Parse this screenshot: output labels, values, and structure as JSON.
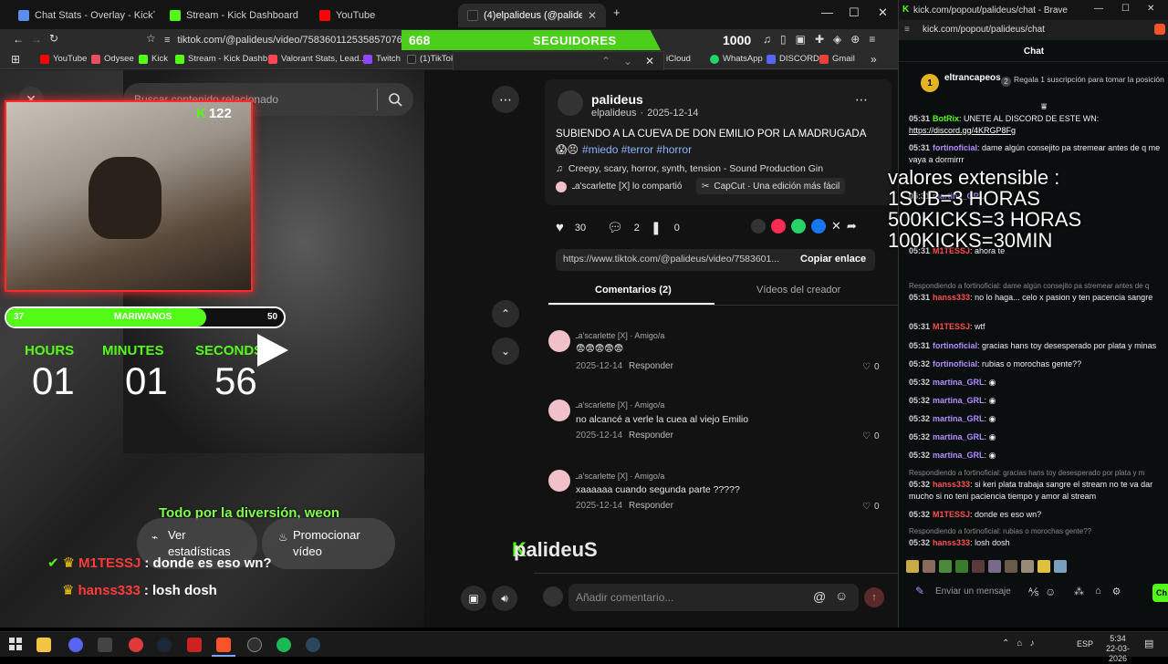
{
  "tabs": [
    {
      "label": "Chat Stats - Overlay - KickTools",
      "color": "#5b8def"
    },
    {
      "label": "Stream - Kick Dashboard",
      "color": "#53fc18"
    },
    {
      "label": "YouTube",
      "color": "#ff0000"
    },
    {
      "label": "(4)elpalideus (@palideus) | TikTok",
      "color": "#222222"
    }
  ],
  "address": "tiktok.com/@palideus/video/7583601125358570763",
  "bookmarks": [
    {
      "label": "YouTube",
      "color": "#ff0000"
    },
    {
      "label": "Odysee",
      "color": "#e5505a"
    },
    {
      "label": "Kick",
      "color": "#53fc18"
    },
    {
      "label": "Stream - Kick Dashb...",
      "color": "#53fc18"
    },
    {
      "label": "Valorant Stats, Lead...",
      "color": "#ff4655"
    },
    {
      "label": "Twitch",
      "color": "#9146ff"
    },
    {
      "label": "(1)TikTok",
      "color": "#222222"
    },
    {
      "label": "iCloud",
      "color": "#bbbbbb"
    },
    {
      "label": "WhatsApp",
      "color": "#25d366"
    },
    {
      "label": "DISCORD",
      "color": "#5865f2"
    },
    {
      "label": "Gmail",
      "color": "#ea4335"
    }
  ],
  "followers_overlay": {
    "current": "668",
    "label": "SEGUIDORES",
    "goal": "1000"
  },
  "search": {
    "placeholder": "Buscar contenido relacionado"
  },
  "viewer_count": "122",
  "goal_bar": {
    "start": "37",
    "label": "MARIWANOS",
    "end": "50",
    "fraction": 0.72
  },
  "timer": {
    "hours_label": "HOURS",
    "minutes_label": "MINUTES",
    "seconds_label": "SECONDS",
    "hours": "01",
    "minutes": "01",
    "seconds": "56"
  },
  "overlay_caption": "Todo por la diversión, weon",
  "video_buttons": {
    "stats": "Ver estadísticas",
    "promote": "Promocionar vídeo"
  },
  "overlay_chat": [
    {
      "user": "M1TESSJ",
      "text": ": donde es eso wn?",
      "color": "#ff3a3a"
    },
    {
      "user": "hanss333",
      "text": ": losh dosh",
      "color": "#ff3a3a"
    }
  ],
  "overlay_brand": "palideuS",
  "post": {
    "author_name": "palideus",
    "author_handle": "elpalideus",
    "date": "2025-12-14",
    "caption": "SUBIENDO A LA CUEVA DE DON EMILIO POR LA MADRUGADA",
    "tags": "#miedo #terror #horror",
    "sound": "Creepy, scary, horror, synth, tension - Sound Production Gin",
    "shared_by": "ـa'scarlette [X] lo compartió",
    "capcut": "CapCut · Una edición más fácil",
    "likes": "30",
    "comments": "2",
    "saves": "0",
    "link": "https://www.tiktok.com/@palideus/video/7583601...",
    "copy_label": "Copiar enlace",
    "tab_comments": "Comentarios (2)",
    "tab_videos": "Vídeos del creador"
  },
  "comments": [
    {
      "user": "ـa'scarlette [X] · Amigo/a",
      "text": "😨😨😨😨😨",
      "date": "2025-12-14",
      "reply": "Responder",
      "likes": "0"
    },
    {
      "user": "ـa'scarlette [X] · Amigo/a",
      "text": "no alcancé a verle la cuea al viejo Emilio",
      "date": "2025-12-14",
      "reply": "Responder",
      "likes": "0"
    },
    {
      "user": "ـa'scarlette [X] · Amigo/a",
      "text": "xaaaaaa cuando segunda parte ?????",
      "date": "2025-12-14",
      "reply": "Responder",
      "likes": "0"
    }
  ],
  "comment_input": {
    "placeholder": "Añadir comentario..."
  },
  "chat_window": {
    "address": "kick.com/popout/palideus/chat - Brave",
    "url": "kick.com/popout/palideus/chat",
    "header": "Chat",
    "pinned_user": "eltrancapeos",
    "pinned_count": "1",
    "gift_text": "Regala 1 suscripción para tomar la posición",
    "gift_pos": "2",
    "input_placeholder": "Enviar un mensaje",
    "send_label": "Ch"
  },
  "extension_overlay": [
    "valores extensible :",
    "1SUB=3 HORAS",
    "500KICKS=3 HORAS",
    "100KICKS=30MIN"
  ],
  "chat_messages": [
    {
      "time": "05:31",
      "user": "BotRix",
      "color": "#53fc18",
      "text": ": UNETE AL DISCORD DE ESTE WN:",
      "link": "https://discord.gg/4KRGP8Fg"
    },
    {
      "time": "05:31",
      "user": "fortinoficial",
      "color": "#b28dff",
      "text": ": dame algún consejito pa stremear antes de q me vaya a dormirrr"
    },
    {
      "time": "05:31",
      "user": "martina_GRL",
      "color": "#b28dff",
      "text": ":"
    },
    {
      "time": "05:31",
      "user": "M1TESSJ",
      "color": "#ff4d4d",
      "text": ": ahora te"
    },
    {
      "time": "05:31",
      "user": "hanss333",
      "color": "#ff4d4d",
      "text": ": no lo haga... celo x pasion y ten pacencia sangre"
    },
    {
      "time": "05:31",
      "user": "M1TESSJ",
      "color": "#ff4d4d",
      "text": ": wtf"
    },
    {
      "time": "05:31",
      "user": "fortinoficial",
      "color": "#b28dff",
      "text": ": gracias hans toy desesperado por plata y minas"
    },
    {
      "time": "05:32",
      "user": "fortinoficial",
      "color": "#b28dff",
      "text": ": rubias o morochas gente??"
    },
    {
      "time": "05:32",
      "user": "martina_GRL",
      "color": "#b28dff",
      "text": ":"
    },
    {
      "time": "05:32",
      "user": "martina_GRL",
      "color": "#b28dff",
      "text": ":"
    },
    {
      "time": "05:32",
      "user": "martina_GRL",
      "color": "#b28dff",
      "text": ":"
    },
    {
      "time": "05:32",
      "user": "martina_GRL",
      "color": "#b28dff",
      "text": ":"
    },
    {
      "time": "05:32",
      "user": "martina_GRL",
      "color": "#b28dff",
      "text": ":"
    },
    {
      "time": "05:32",
      "user": "hanss333",
      "color": "#ff4d4d",
      "text": ": si keri plata trabaja sangre el stream no te va dar mucho si no teni paciencia tiempo y amor al stream"
    },
    {
      "time": "05:32",
      "user": "M1TESSJ",
      "color": "#ff4d4d",
      "text": ": donde es eso wn?"
    },
    {
      "time": "05:32",
      "user": "hanss333",
      "color": "#ff4d4d",
      "text": ": losh dosh"
    }
  ],
  "reply_notes": [
    "Respondiendo a fortinoficial: dame algún consejito pa stremear antes de q",
    "Respondiendo a fortinoficial: gracias hans toy desesperado por plata y m",
    "Respondiendo a fortinoficial: rubias o morochas gente??"
  ],
  "tray": {
    "lang": "ESP",
    "time": "5:34",
    "date": "22-03-2026"
  },
  "taskbar_icons": [
    {
      "name": "file-explorer-icon",
      "color": "#f4c542"
    },
    {
      "name": "discord-icon",
      "color": "#5865f2"
    },
    {
      "name": "epic-games-icon",
      "color": "#444444"
    },
    {
      "name": "app-red-icon",
      "color": "#e03a3a"
    },
    {
      "name": "steam-icon",
      "color": "#1b2838"
    },
    {
      "name": "app-stripes-icon",
      "color": "#cc2222"
    },
    {
      "name": "brave-icon",
      "color": "#fb542b"
    },
    {
      "name": "obs-icon",
      "color": "#302e31"
    },
    {
      "name": "spotify-icon",
      "color": "#1db954"
    },
    {
      "name": "steam-2-icon",
      "color": "#2a475e"
    }
  ]
}
